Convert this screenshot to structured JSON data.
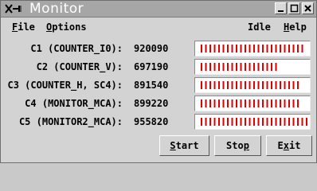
{
  "window": {
    "title": "Monitor"
  },
  "menu": {
    "file": {
      "mnemonic": "F",
      "rest": "ile"
    },
    "options": {
      "mnemonic": "O",
      "rest": "ptions"
    },
    "status": "Idle",
    "help": {
      "mnemonic": "H",
      "rest": "elp"
    }
  },
  "rows": [
    {
      "label": "C1 (COUNTER_I0):",
      "value": "920090",
      "ticks": 24
    },
    {
      "label": "C2 (COUNTER_V):",
      "value": "697190",
      "ticks": 18
    },
    {
      "label": "C3 (COUNTER_H, SC4):",
      "value": "891540",
      "ticks": 23
    },
    {
      "label": "C4 (MONITOR_MCA):",
      "value": "899220",
      "ticks": 23
    },
    {
      "label": "C5 (MONITOR2_MCA):",
      "value": "955820",
      "ticks": 25
    }
  ],
  "buttons": {
    "start": {
      "mnemonic": "S",
      "rest": "tart"
    },
    "stop": {
      "pre": "Sto",
      "mnemonic": "p",
      "rest": ""
    },
    "exit": {
      "pre": "E",
      "mnemonic": "x",
      "rest": "it"
    }
  },
  "colors": {
    "bar_tick": "#e00000",
    "titlebar": "#a6a6a6"
  },
  "icons": [
    "app-menu-icon",
    "minimize-icon",
    "maximize-icon",
    "close-icon"
  ]
}
